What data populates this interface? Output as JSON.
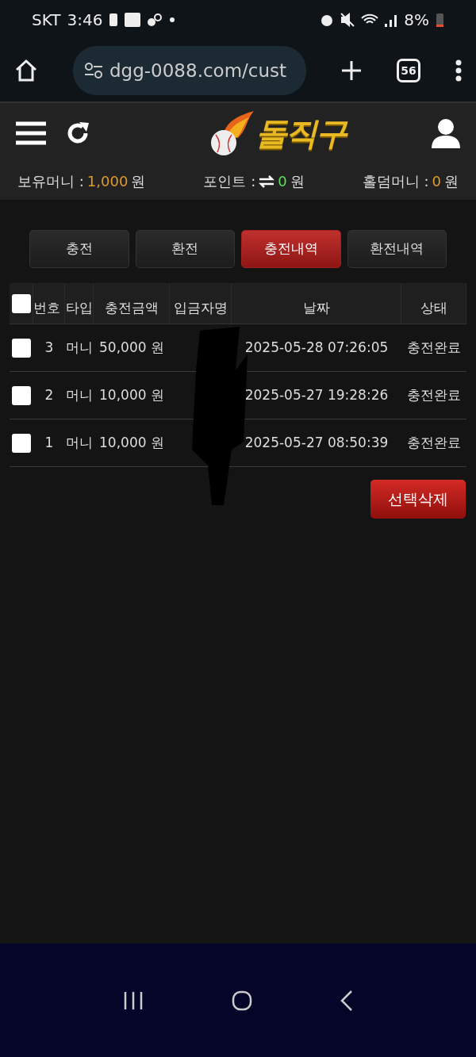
{
  "status_bar": {
    "carrier": "SKT",
    "time": "3:46",
    "battery": "8%"
  },
  "browser": {
    "url": "dgg-0088.com/cust",
    "tab_count": "56"
  },
  "header": {
    "logo": "돌직구"
  },
  "balances": [
    {
      "label": "보유머니 :",
      "value": "1,000",
      "unit": "원",
      "kind": "money",
      "color": "#e09a2c"
    },
    {
      "label": "포인트 :",
      "value": "0",
      "unit": "원",
      "kind": "point",
      "color": "#5ee05e"
    },
    {
      "label": "홀덤머니 :",
      "value": "0",
      "unit": "원",
      "kind": "money",
      "color": "#e09a2c"
    }
  ],
  "tabs": [
    {
      "label": "충전",
      "selected": false
    },
    {
      "label": "환전",
      "selected": false
    },
    {
      "label": "충전내역",
      "selected": true
    },
    {
      "label": "환전내역",
      "selected": false
    }
  ],
  "table": {
    "select_all_checked": false,
    "columns": [
      "번호",
      "타입",
      "충전금액",
      "입금자명",
      "날짜",
      "상태"
    ],
    "rows": [
      {
        "checked": false,
        "number": "3",
        "type": "머니",
        "amount": "50,000 원",
        "date": "2025-05-28 07:26:05",
        "status": "충전완료"
      },
      {
        "checked": false,
        "number": "2",
        "type": "머니",
        "amount": "10,000 원",
        "date": "2025-05-27 19:28:26",
        "status": "충전완료"
      },
      {
        "checked": false,
        "number": "1",
        "type": "머니",
        "amount": "10,000 원",
        "date": "2025-05-27 08:50:39",
        "status": "충전완료"
      }
    ]
  },
  "delete_button": "선택삭제"
}
